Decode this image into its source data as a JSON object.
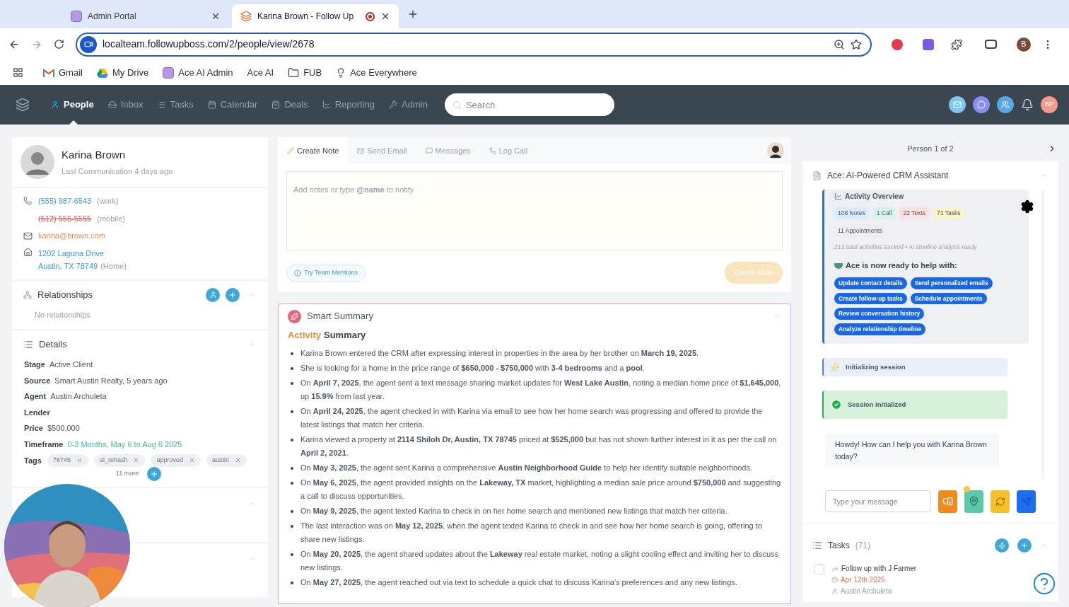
{
  "browser": {
    "tabs": [
      {
        "title": "Admin Portal",
        "selected": false,
        "recording": false
      },
      {
        "title": "Karina Brown - Follow Up",
        "selected": true,
        "recording": true
      }
    ],
    "url": "localteam.followupboss.com/2/people/view/2678",
    "profile": "B",
    "bookmarks": [
      {
        "label": "Gmail",
        "kind": "gmail"
      },
      {
        "label": "My Drive",
        "kind": "drive"
      },
      {
        "label": "Ace AI Admin",
        "kind": "square"
      },
      {
        "label": "Ace AI",
        "kind": "none"
      },
      {
        "label": "FUB",
        "kind": "folder"
      },
      {
        "label": "Ace Everywhere",
        "kind": "bulb"
      }
    ]
  },
  "nav": {
    "items": [
      {
        "label": "People",
        "kind": "people",
        "selected": true
      },
      {
        "label": "Inbox",
        "kind": "inbox",
        "selected": false
      },
      {
        "label": "Tasks",
        "kind": "tasks",
        "selected": false
      },
      {
        "label": "Calendar",
        "kind": "calendar",
        "selected": false
      },
      {
        "label": "Deals",
        "kind": "deals",
        "selected": false
      },
      {
        "label": "Reporting",
        "kind": "reporting",
        "selected": false
      },
      {
        "label": "Admin",
        "kind": "admin",
        "selected": false
      }
    ],
    "search": {
      "placeholder": "Search"
    },
    "avatar": "BP"
  },
  "contact": {
    "name": "Karina Brown",
    "last_communication": "Last Communication 4 days ago",
    "phones": [
      {
        "number": "(555) 987-6543",
        "type": "(work)",
        "invalid": false
      },
      {
        "number": "(512) 555-5555",
        "type": "(mobile)",
        "invalid": true
      }
    ],
    "email": "karina@brown.com",
    "address": [
      "1202 Laguna Drive",
      "Austin, TX 78749"
    ],
    "address_type": "(Home)"
  },
  "relationships": {
    "title": "Relationships",
    "empty": "No relationships"
  },
  "details": {
    "title": "Details",
    "fields": [
      {
        "label": "Stage",
        "value": "Active Client",
        "kind": "plain"
      },
      {
        "label": "Source",
        "value": "Smart Austin Realty, 5 years ago",
        "kind": "plain"
      },
      {
        "label": "Agent",
        "value": "Austin Archuleta",
        "kind": "plain"
      },
      {
        "label": "Lender",
        "kind": "plain"
      },
      {
        "label": "Price",
        "value": "$500,000",
        "kind": "plain"
      },
      {
        "label": "Timeframe",
        "value": "0-3 Months, May 6 to Aug 6 2025",
        "kind": "range"
      }
    ],
    "tags_label": "Tags",
    "tags": [
      "78745",
      "ai_rehash",
      "approved",
      "austin"
    ],
    "more": "11 more"
  },
  "composer": {
    "tabs": [
      {
        "label": "Create Note",
        "kind": "note",
        "selected": true
      },
      {
        "label": "Send Email",
        "kind": "email",
        "selected": false
      },
      {
        "label": "Messages",
        "kind": "messages",
        "selected": false
      },
      {
        "label": "Log Call",
        "kind": "call",
        "selected": false
      }
    ],
    "placeholder": "Add notes or type **@name** to notify",
    "mentions": "Try Team Mentions",
    "button": "Create Note"
  },
  "summary": {
    "title": "Smart Summary",
    "heading_accent": "Activity",
    "heading": "Summary",
    "bullets": [
      "Karina Brown entered the CRM after expressing interest in properties in the area by her brother on **March 19, 2025**.",
      "She is looking for a home in the price range of **$650,000 - $750,000** with **3-4 bedrooms** and a **pool**.",
      "On **April 7, 2025**, the agent sent a text message sharing market updates for **West Lake Austin**, noting a median home price of **$1,645,000**, up **15.9%** from last year.",
      "On **April 24, 2025**, the agent checked in with Karina via email to see how her home search was progressing and offered to provide the latest listings that match her criteria.",
      "Karina viewed a property at **2114 Shiloh Dr, Austin, TX 78745** priced at **$525,000** but has not shown further interest in it as per the call on **April 2, 2021**.",
      "On **May 3, 2025**, the agent sent Karina a comprehensive **Austin Neighborhood Guide** to help her identify suitable neighborhoods.",
      "On **May 6, 2025**, the agent provided insights on the **Lakeway, TX** market, highlighting a median sale price around **$750,000** and suggesting a call to discuss opportunities.",
      "On **May 9, 2025**, the agent texted Karina to check in on her home search and mentioned new listings that match her criteria.",
      "The last interaction was on **May 12, 2025**, when the agent texted Karina to check in and see how her home search is going, offering to share new listings.",
      "On **May 20, 2025**, the agent shared updates about the **Lakeway** real estate market, noting a slight cooling effect and inviting her to discuss new listings.",
      "On **May 27, 2025**, the agent reached out via text to schedule a quick chat to discuss Karina's preferences and any new listings."
    ]
  },
  "pager": "Person 1 of 2",
  "ace": {
    "title": "Ace: AI-Powered CRM Assistant",
    "overview_title": "Activity Overview",
    "counts": [
      {
        "label": "108 Notes",
        "color": "#dbeafe"
      },
      {
        "label": "1 Call",
        "color": "#d5f3ec"
      },
      {
        "label": "22 Texts",
        "color": "#fde0e0"
      },
      {
        "label": "71 Tasks",
        "color": "#fdf3c9"
      },
      {
        "label": "11 Appointments",
        "color": "#eceef1"
      }
    ],
    "total": "213 total activities tracked • AI timeline analysis ready",
    "ready": "Ace is now ready to help with:",
    "actions": [
      "Update contact details",
      "Send personalized emails",
      "Create follow-up tasks",
      "Schedule appointments",
      "Review conversation history",
      "Analyze relationship timeline"
    ],
    "statuses": [
      {
        "label": "Initializing session",
        "kind": "progress"
      },
      {
        "label": "Session initialized",
        "kind": "success"
      }
    ],
    "message": "Howdy! How can I help you with Karina Brown today?",
    "input_placeholder": "Type your message"
  },
  "tasks": {
    "title": "Tasks",
    "count": "(71)",
    "items": [
      {
        "title": "Follow up with J Farmer",
        "due": "Apr 12th 2025",
        "assignee": "Austin Archuleta",
        "done": false
      }
    ]
  }
}
